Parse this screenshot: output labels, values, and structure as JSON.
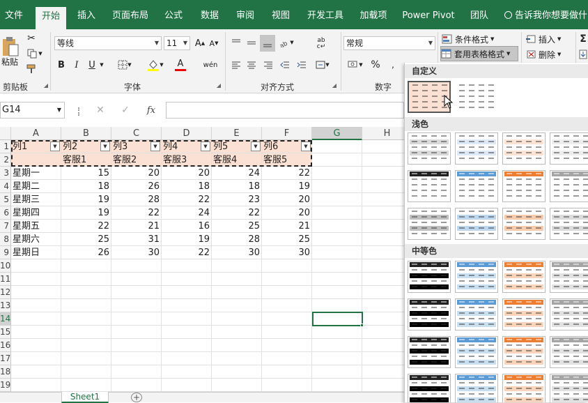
{
  "tabs": [
    "文件",
    "开始",
    "插入",
    "页面布局",
    "公式",
    "数据",
    "审阅",
    "视图",
    "开发工具",
    "加载项",
    "Power Pivot",
    "团队"
  ],
  "tell_me": "告诉我你想要做什",
  "clipboard": {
    "paste": "粘贴",
    "label": "剪贴板"
  },
  "font": {
    "name": "等线",
    "size": "11",
    "label": "字体",
    "bold": "B",
    "italic": "I",
    "underline": "U",
    "grow": "A",
    "shrink": "A",
    "color_letter": "A",
    "phonetic": "wén"
  },
  "alignment": {
    "label": "对齐方式"
  },
  "number": {
    "format": "常规",
    "label": "数字",
    "percent": "%"
  },
  "styles": {
    "cond_format": "条件格式",
    "table_format": "套用表格格式"
  },
  "cells": {
    "insert": "插入",
    "delete": "删除"
  },
  "name_box": "G14",
  "fx": "fx",
  "columns": [
    "A",
    "B",
    "C",
    "D",
    "E",
    "F",
    "G",
    "H"
  ],
  "rows": [
    "1",
    "2",
    "3",
    "4",
    "5",
    "6",
    "7",
    "8",
    "9",
    "10",
    "11",
    "12",
    "13",
    "14",
    "15",
    "16",
    "17",
    "18",
    "19"
  ],
  "table": {
    "headers": [
      "列1",
      "列2",
      "列3",
      "列4",
      "列5",
      "列6"
    ],
    "row2": [
      "",
      "客服1",
      "客服2",
      "客服3",
      "客服4",
      "客服5"
    ],
    "data": [
      [
        "星期一",
        "15",
        "20",
        "20",
        "24",
        "22"
      ],
      [
        "星期二",
        "18",
        "26",
        "18",
        "18",
        "19"
      ],
      [
        "星期三",
        "19",
        "28",
        "22",
        "23",
        "20"
      ],
      [
        "星期四",
        "19",
        "22",
        "24",
        "22",
        "20"
      ],
      [
        "星期五",
        "22",
        "21",
        "16",
        "25",
        "21"
      ],
      [
        "星期六",
        "25",
        "31",
        "19",
        "28",
        "25"
      ],
      [
        "星期日",
        "26",
        "30",
        "22",
        "30",
        "30"
      ]
    ]
  },
  "sheet_tab": "Sheet1",
  "panel": {
    "custom": "自定义",
    "light": "浅色",
    "medium": "中等色"
  },
  "colors": {
    "brand": "#217346",
    "header_fill": "#fbe1d4",
    "blue": "#5b9bd5",
    "orange": "#ed7d31",
    "gray": "#a5a5a5"
  }
}
